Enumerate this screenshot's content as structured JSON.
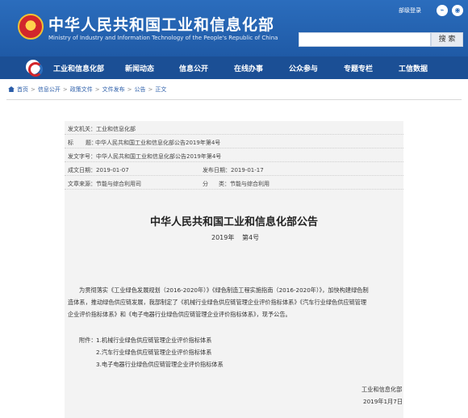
{
  "header": {
    "title": "中华人民共和国工业和信息化部",
    "subtitle": "Ministry of Industry and Information Technology of the People's Republic of China",
    "mail_link": "部级登录",
    "search_placeholder": "",
    "search_button": "搜 索",
    "icons": [
      "emblem-icon",
      "rss-icon",
      "weibo-icon"
    ]
  },
  "nav": {
    "items": [
      "工业和信息化部",
      "新闻动态",
      "信息公开",
      "在线办事",
      "公众参与",
      "专题专栏",
      "工信数据"
    ]
  },
  "breadcrumb": [
    "首页",
    "信息公开",
    "政策文件",
    "文件发布",
    "公告",
    "正文"
  ],
  "meta": {
    "issuer": "发文机关：工业和信息化部",
    "title_label": "标",
    "title_label2": "题：",
    "title_value": "中华人民共和国工业和信息化部公告2019年第4号",
    "doc_no": "发文字号：中华人民共和国工业和信息化部公告2019年第4号",
    "date": "成文日期：2019-01-07",
    "publish_date": "发布日期：2019-01-17",
    "source": "文章来源：节能与综合利用司",
    "category_label": "分",
    "category_value": "类：节能与综合利用"
  },
  "doc": {
    "title": "中华人民共和国工业和信息化部公告",
    "year": "2019年",
    "number": "第4号",
    "para_line1": "为贯彻落实《工业绿色发展规划（2016-2020年）》《绿色制造工程实施指南（2016-2020年）》，加快构建绿色制",
    "para_line2": "造体系，推动绿色供应链发展，我部制定了《机械行业绿色供应链管理企业评价指标体系》《汽车行业绿色供应链管理",
    "para_line3": "企业评价指标体系》和《电子电器行业绿色供应链管理企业评价指标体系》，现予公告。",
    "attachment_label": "附件：",
    "attachments": [
      "1.机械行业绿色供应链管理企业评价指标体系",
      "2.汽车行业绿色供应链管理企业评价指标体系",
      "3.电子电器行业绿色供应链管理企业评价指标体系"
    ],
    "signature": "工业和信息化部",
    "signature_date": "2019年1月7日"
  }
}
